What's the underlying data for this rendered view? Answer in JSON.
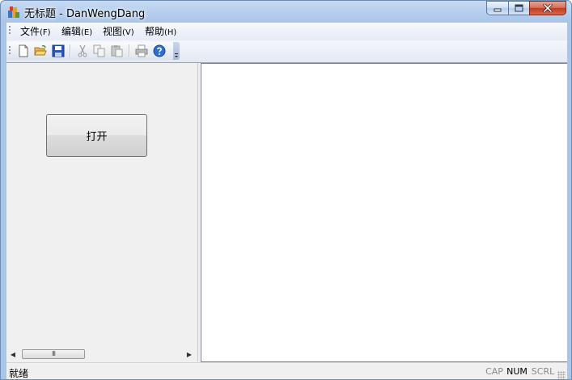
{
  "window": {
    "title": "无标题 - DanWengDang",
    "colors": {
      "frame": "#a9c5e9",
      "close_button": "#c0391e",
      "client_bg": "#f0f0f0"
    }
  },
  "title_controls": {
    "minimize_icon": "minimize-icon",
    "maximize_icon": "maximize-icon",
    "close_icon": "close-icon"
  },
  "menu": {
    "items": [
      {
        "label": "文件",
        "accel": "(F)"
      },
      {
        "label": "编辑",
        "accel": "(E)"
      },
      {
        "label": "视图",
        "accel": "(V)"
      },
      {
        "label": "帮助",
        "accel": "(H)"
      }
    ]
  },
  "toolbar": {
    "buttons": [
      {
        "icon": "new-file-icon"
      },
      {
        "icon": "open-folder-icon"
      },
      {
        "icon": "save-icon"
      },
      {
        "icon": "cut-icon"
      },
      {
        "icon": "copy-icon"
      },
      {
        "icon": "paste-icon"
      },
      {
        "icon": "print-icon"
      },
      {
        "icon": "help-icon"
      }
    ]
  },
  "left_pane": {
    "open_button_label": "打开",
    "scroll_thumb_glyph": "III"
  },
  "status": {
    "text": "就绪",
    "indicators": [
      {
        "label": "CAP",
        "active": false
      },
      {
        "label": "NUM",
        "active": true
      },
      {
        "label": "SCRL",
        "active": false
      }
    ]
  }
}
